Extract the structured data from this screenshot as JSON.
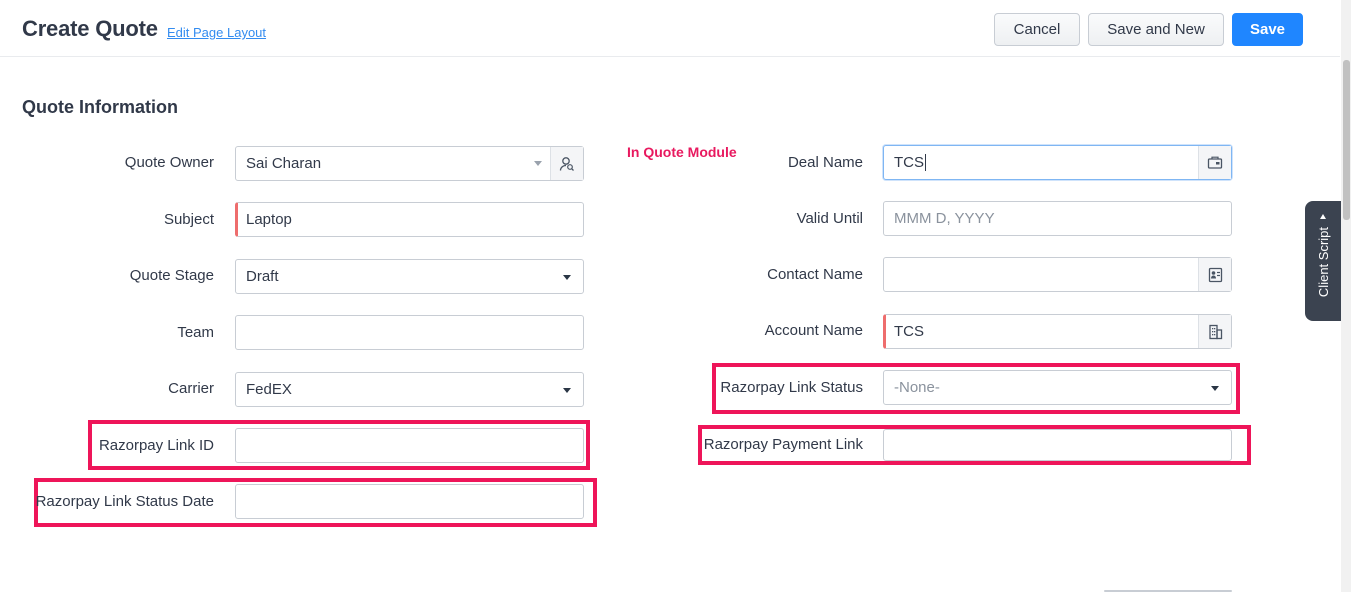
{
  "header": {
    "title": "Create Quote",
    "edit_layout_link": "Edit Page Layout",
    "buttons": {
      "cancel": "Cancel",
      "save_and_new": "Save and New",
      "save": "Save"
    }
  },
  "section": {
    "title": "Quote Information"
  },
  "annotation_note": "In Quote Module",
  "left_fields": {
    "quote_owner": {
      "label": "Quote Owner",
      "value": "Sai Charan"
    },
    "subject": {
      "label": "Subject",
      "value": "Laptop"
    },
    "quote_stage": {
      "label": "Quote Stage",
      "value": "Draft"
    },
    "team": {
      "label": "Team",
      "value": ""
    },
    "carrier": {
      "label": "Carrier",
      "value": "FedEX"
    },
    "razorpay_link_id": {
      "label": "Razorpay Link ID",
      "value": ""
    },
    "razorpay_link_status_date": {
      "label": "Razorpay Link Status Date",
      "value": ""
    }
  },
  "right_fields": {
    "deal_name": {
      "label": "Deal Name",
      "value": "TCS"
    },
    "valid_until": {
      "label": "Valid Until",
      "placeholder": "MMM D, YYYY"
    },
    "contact_name": {
      "label": "Contact Name",
      "value": ""
    },
    "account_name": {
      "label": "Account Name",
      "value": "TCS"
    },
    "razorpay_link_status": {
      "label": "Razorpay Link Status",
      "value": "-None-"
    },
    "razorpay_payment_link": {
      "label": "Razorpay Payment Link",
      "value": ""
    }
  },
  "client_script": {
    "label": "Client Script"
  },
  "colors": {
    "primary": "#1f86ff",
    "annotation": "#ee1559",
    "mandatory": "#ee6d6d",
    "link": "#338cf0"
  }
}
